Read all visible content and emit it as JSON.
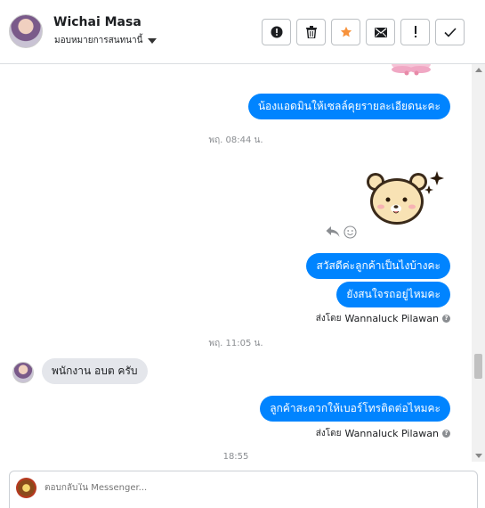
{
  "header": {
    "name": "Wichai Masa",
    "assign_label": "มอบหมายการสนทนานี้"
  },
  "actions": [
    {
      "name": "report-button",
      "icon": "exclamation-circle-icon"
    },
    {
      "name": "delete-button",
      "icon": "trash-icon"
    },
    {
      "name": "star-button",
      "icon": "star-icon",
      "color": "#f7923b"
    },
    {
      "name": "mark-unread-button",
      "icon": "envelope-icon"
    },
    {
      "name": "follow-up-button",
      "icon": "exclamation-icon"
    },
    {
      "name": "mark-done-button",
      "icon": "check-icon"
    }
  ],
  "messages": {
    "m1": "น้องแอดมินให้เซลล์คุยรายละเอียดนะคะ",
    "ts1": "พฤ. 08:44 น.",
    "m2": "สวัสดีค่ะลูกค้าเป็นไงบ้างคะ",
    "m3": "ยังสนใจรถอยู่ไหมคะ",
    "sent_by_label": "ส่งโดย",
    "sent_by_name": "Wannaluck Pilawan",
    "ts2": "พฤ. 11:05 น.",
    "m4": "พนักงาน อบต ครับ",
    "m5": "ลูกค้าสะดวกให้เบอร์โทรติดต่อไหมคะ",
    "ts3": "18:55"
  },
  "composer": {
    "placeholder": "ตอบกลับใน Messenger..."
  },
  "colors": {
    "outgoing_bubble": "#0084ff",
    "incoming_bubble": "#e4e6eb",
    "star": "#f7923b"
  }
}
